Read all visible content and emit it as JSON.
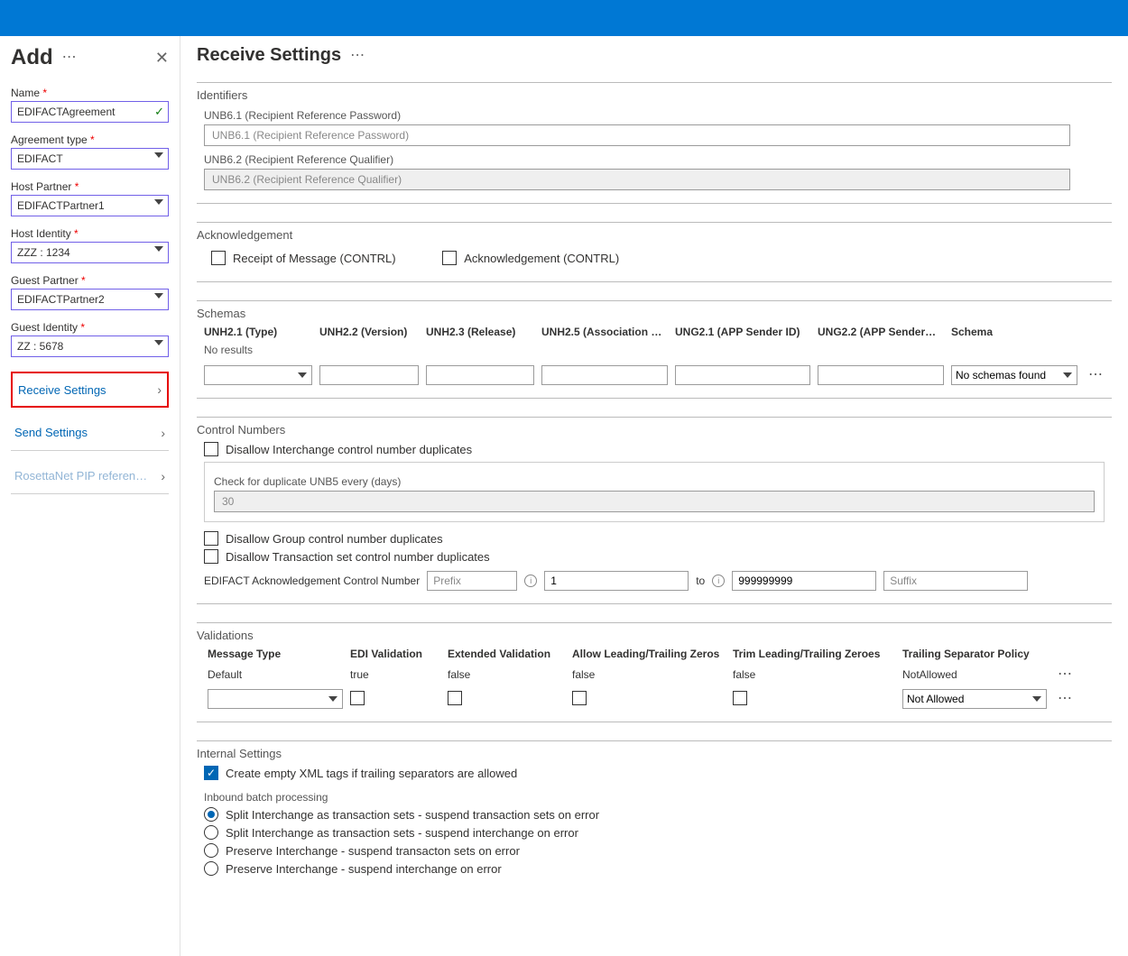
{
  "left": {
    "title": "Add",
    "fields": {
      "name_label": "Name",
      "name_value": "EDIFACTAgreement",
      "agreement_type_label": "Agreement type",
      "agreement_type_value": "EDIFACT",
      "host_partner_label": "Host Partner",
      "host_partner_value": "EDIFACTPartner1",
      "host_identity_label": "Host Identity",
      "host_identity_value": "ZZZ : 1234",
      "guest_partner_label": "Guest Partner",
      "guest_partner_value": "EDIFACTPartner2",
      "guest_identity_label": "Guest Identity",
      "guest_identity_value": "ZZ : 5678"
    },
    "nav": {
      "receive": "Receive Settings",
      "send": "Send Settings",
      "rosetta": "RosettaNet PIP referen…"
    }
  },
  "main": {
    "title": "Receive Settings",
    "identifiers": {
      "section": "Identifiers",
      "unb61_label": "UNB6.1 (Recipient Reference Password)",
      "unb61_placeholder": "UNB6.1 (Recipient Reference Password)",
      "unb62_label": "UNB6.2 (Recipient Reference Qualifier)",
      "unb62_placeholder": "UNB6.2 (Recipient Reference Qualifier)"
    },
    "ack": {
      "section": "Acknowledgement",
      "receipt": "Receipt of Message (CONTRL)",
      "ack": "Acknowledgement (CONTRL)"
    },
    "schemas": {
      "section": "Schemas",
      "cols": [
        "UNH2.1 (Type)",
        "UNH2.2 (Version)",
        "UNH2.3 (Release)",
        "UNH2.5 (Association …",
        "UNG2.1 (APP Sender ID)",
        "UNG2.2 (APP Sender…",
        "Schema"
      ],
      "no_results": "No results",
      "no_schemas": "No schemas found"
    },
    "control": {
      "section": "Control Numbers",
      "disallow_interchange": "Disallow Interchange control number duplicates",
      "dup_label": "Check for duplicate UNB5 every (days)",
      "dup_value": "30",
      "disallow_group": "Disallow Group control number duplicates",
      "disallow_tx": "Disallow Transaction set control number duplicates",
      "edi_label": "EDIFACT Acknowledgement Control Number",
      "prefix_ph": "Prefix",
      "from_val": "1",
      "to_label": "to",
      "to_val": "999999999",
      "suffix_ph": "Suffix"
    },
    "validations": {
      "section": "Validations",
      "cols": [
        "Message Type",
        "EDI Validation",
        "Extended Validation",
        "Allow Leading/Trailing Zeros",
        "Trim Leading/Trailing Zeroes",
        "Trailing Separator Policy"
      ],
      "row": [
        "Default",
        "true",
        "false",
        "false",
        "false",
        "NotAllowed"
      ],
      "policy_option": "Not Allowed"
    },
    "internal": {
      "section": "Internal Settings",
      "create_empty": "Create empty XML tags if trailing separators are allowed",
      "batch_label": "Inbound batch processing",
      "opts": [
        "Split Interchange as transaction sets - suspend transaction sets on error",
        "Split Interchange as transaction sets - suspend interchange on error",
        "Preserve Interchange - suspend transacton sets on error",
        "Preserve Interchange - suspend interchange on error"
      ]
    }
  }
}
